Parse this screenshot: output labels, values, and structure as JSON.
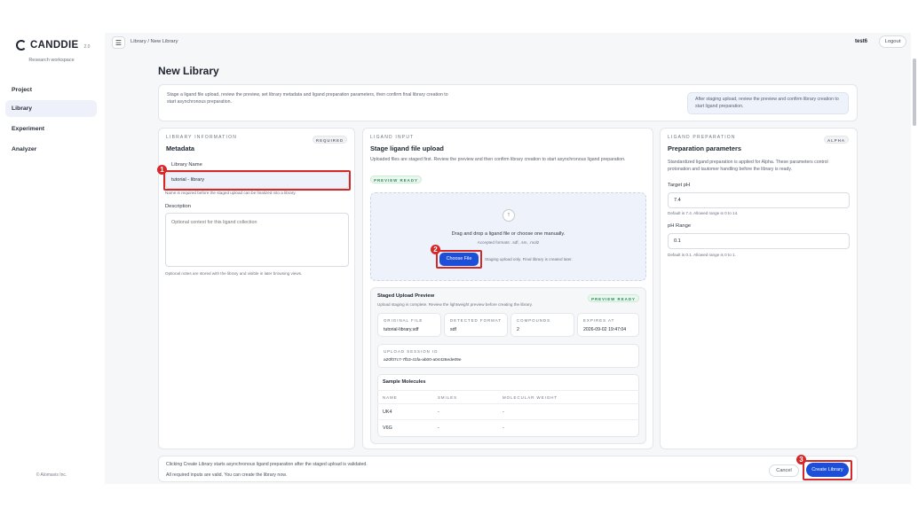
{
  "brand": {
    "name": "CANDDIE",
    "version": "2.0",
    "workspace": "Research workspace"
  },
  "sidebar": {
    "items": [
      {
        "label": "Project"
      },
      {
        "label": "Library"
      },
      {
        "label": "Experiment"
      },
      {
        "label": "Analyzer"
      }
    ],
    "copyright": "© Alomavis Inc."
  },
  "header": {
    "menu_icon": "☰",
    "breadcrumb": "Library / New Library",
    "user": "test6",
    "logout": "Logout"
  },
  "page": {
    "title": "New Library"
  },
  "intro": {
    "text": "Stage a ligand file upload, review the preview, set library metadata and ligand preparation parameters, then confirm final library creation to start asynchronous preparation.",
    "note": "After staging upload, review the preview and confirm library creation to start ligand preparation."
  },
  "metadata": {
    "kicker": "LIBRARY INFORMATION",
    "title": "Metadata",
    "badge": "REQUIRED",
    "name_label": "Library Name",
    "name_value": "tutorial - library",
    "name_hint": "Name is required before the staged upload can be finalized into a library.",
    "desc_label": "Description",
    "desc_placeholder": "Optional context for this ligand collection",
    "desc_hint": "Optional notes are stored with the library and visible in later browsing views."
  },
  "ligand": {
    "kicker": "LIGAND INPUT",
    "title": "Stage ligand file upload",
    "desc": "Uploaded files are staged first. Review the preview and then confirm library creation to start asynchronous ligand preparation.",
    "badge": "PREVIEW READY",
    "upload_icon": "↑",
    "drop_text": "Drag and drop a ligand file or choose one manually.",
    "formats": "Accepted formats: .sdf, .sm, .mol2",
    "choose_label": "Choose File",
    "choose_hint": "Staging upload only. Final library is created later.",
    "preview": {
      "title": "Staged Upload Preview",
      "subtitle": "Upload staging is complete. Review the lightweight preview before creating the library.",
      "badge": "PREVIEW READY",
      "stats": [
        {
          "key": "ORIGINAL FILE",
          "value": "tutorial-library.sdf"
        },
        {
          "key": "DETECTED FORMAT",
          "value": "sdf"
        },
        {
          "key": "COMPOUNDS",
          "value": "2"
        },
        {
          "key": "EXPIRES AT",
          "value": "2026-09-02 19:47:04"
        }
      ],
      "session_key": "UPLOAD SESSION ID",
      "session_value": "a20f07c7-7fb3-41fa-ab00-a04426ede09e",
      "table": {
        "title": "Sample Molecules",
        "headers": [
          "NAME",
          "SMILES",
          "MOLECULAR WEIGHT"
        ],
        "rows": [
          [
            "UK4",
            "-",
            "-"
          ],
          [
            "V6G",
            "-",
            "-"
          ]
        ]
      }
    }
  },
  "prep": {
    "kicker": "LIGAND PREPARATION",
    "title": "Preparation parameters",
    "badge": "ALPHA",
    "desc": "Standardized ligand preparation is applied for Alpha. These parameters control protonation and tautomer handling before the library is ready.",
    "ph_label": "Target pH",
    "ph_value": "7.4",
    "ph_hint": "Default is 7.4. Allowed range is 0 to 14.",
    "range_label": "pH Range",
    "range_value": "0.1",
    "range_hint": "Default is 0.1. Allowed range is 0 to 1."
  },
  "footer": {
    "line1": "Clicking Create Library starts asynchronous ligand preparation after the staged upload is validated.",
    "line2": "All required inputs are valid. You can create the library now.",
    "cancel": "Cancel",
    "create": "Create Library"
  },
  "annotations": {
    "m1": "1",
    "m2": "2",
    "m3": "3"
  },
  "colors": {
    "accent": "#1d4ed8",
    "highlight": "#d62828",
    "success": "#2a8a55"
  }
}
